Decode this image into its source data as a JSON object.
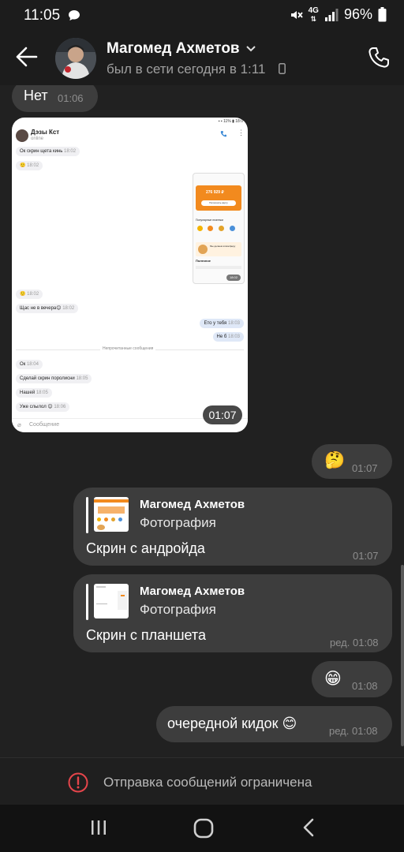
{
  "status_bar": {
    "time": "11:05",
    "network": "4G",
    "battery": "96%"
  },
  "header": {
    "contact_name": "Магомед Ахметов",
    "last_seen": "был в сети сегодня в 1:11"
  },
  "chat": {
    "msg_no": {
      "text": "Нет",
      "time": "01:06"
    },
    "image_msg": {
      "time": "01:07",
      "inner": {
        "contact": "Дэзы Кст",
        "status": "online",
        "m1": "Ок скрин щета кинь",
        "t1": "18:02",
        "card_amount": "276 929 ₽",
        "card_button": "Пополнить карту",
        "section_popular": "Популярные платежи",
        "promo": "Мы делаем атмосферу",
        "section_useful": "Полезное",
        "img_time": "18:02",
        "m2": "Щас не в вечера",
        "out1": "Ето у тебя",
        "out2": "Не б",
        "unread_divider": "Непрочитанные сообщения",
        "m3": "Ок",
        "m4": "Сделай скрин поролисни",
        "m5": "Нашей",
        "m6": "Уже слылол",
        "input_placeholder": "Сообщение"
      }
    },
    "msg_thinking": {
      "emoji": "🤔",
      "time": "01:07"
    },
    "reply1": {
      "author": "Магомед Ахметов",
      "type": "Фотография",
      "text": "Скрин с андройда",
      "time": "01:07"
    },
    "reply2": {
      "author": "Магомед Ахметов",
      "type": "Фотография",
      "text": "Скрин с планшета",
      "edited": "ред.",
      "time": "01:08"
    },
    "msg_grin": {
      "emoji": "😁",
      "time": "01:08"
    },
    "msg_last": {
      "text": "очередной кидок 😊",
      "edited": "ред.",
      "time": "01:08"
    }
  },
  "restricted_notice": "Отправка сообщений ограничена",
  "colors": {
    "background": "#212121",
    "bubble": "#3d3d3d",
    "accent_orange": "#f28a1e",
    "alert_red": "#e5454b"
  },
  "icons": [
    "chat-bubble-icon",
    "mute-icon",
    "signal-icon",
    "battery-icon",
    "back-arrow-icon",
    "chevron-down-icon",
    "phone-device-icon",
    "phone-call-icon",
    "alert-circle-icon",
    "recents-icon",
    "home-icon",
    "back-nav-icon"
  ]
}
